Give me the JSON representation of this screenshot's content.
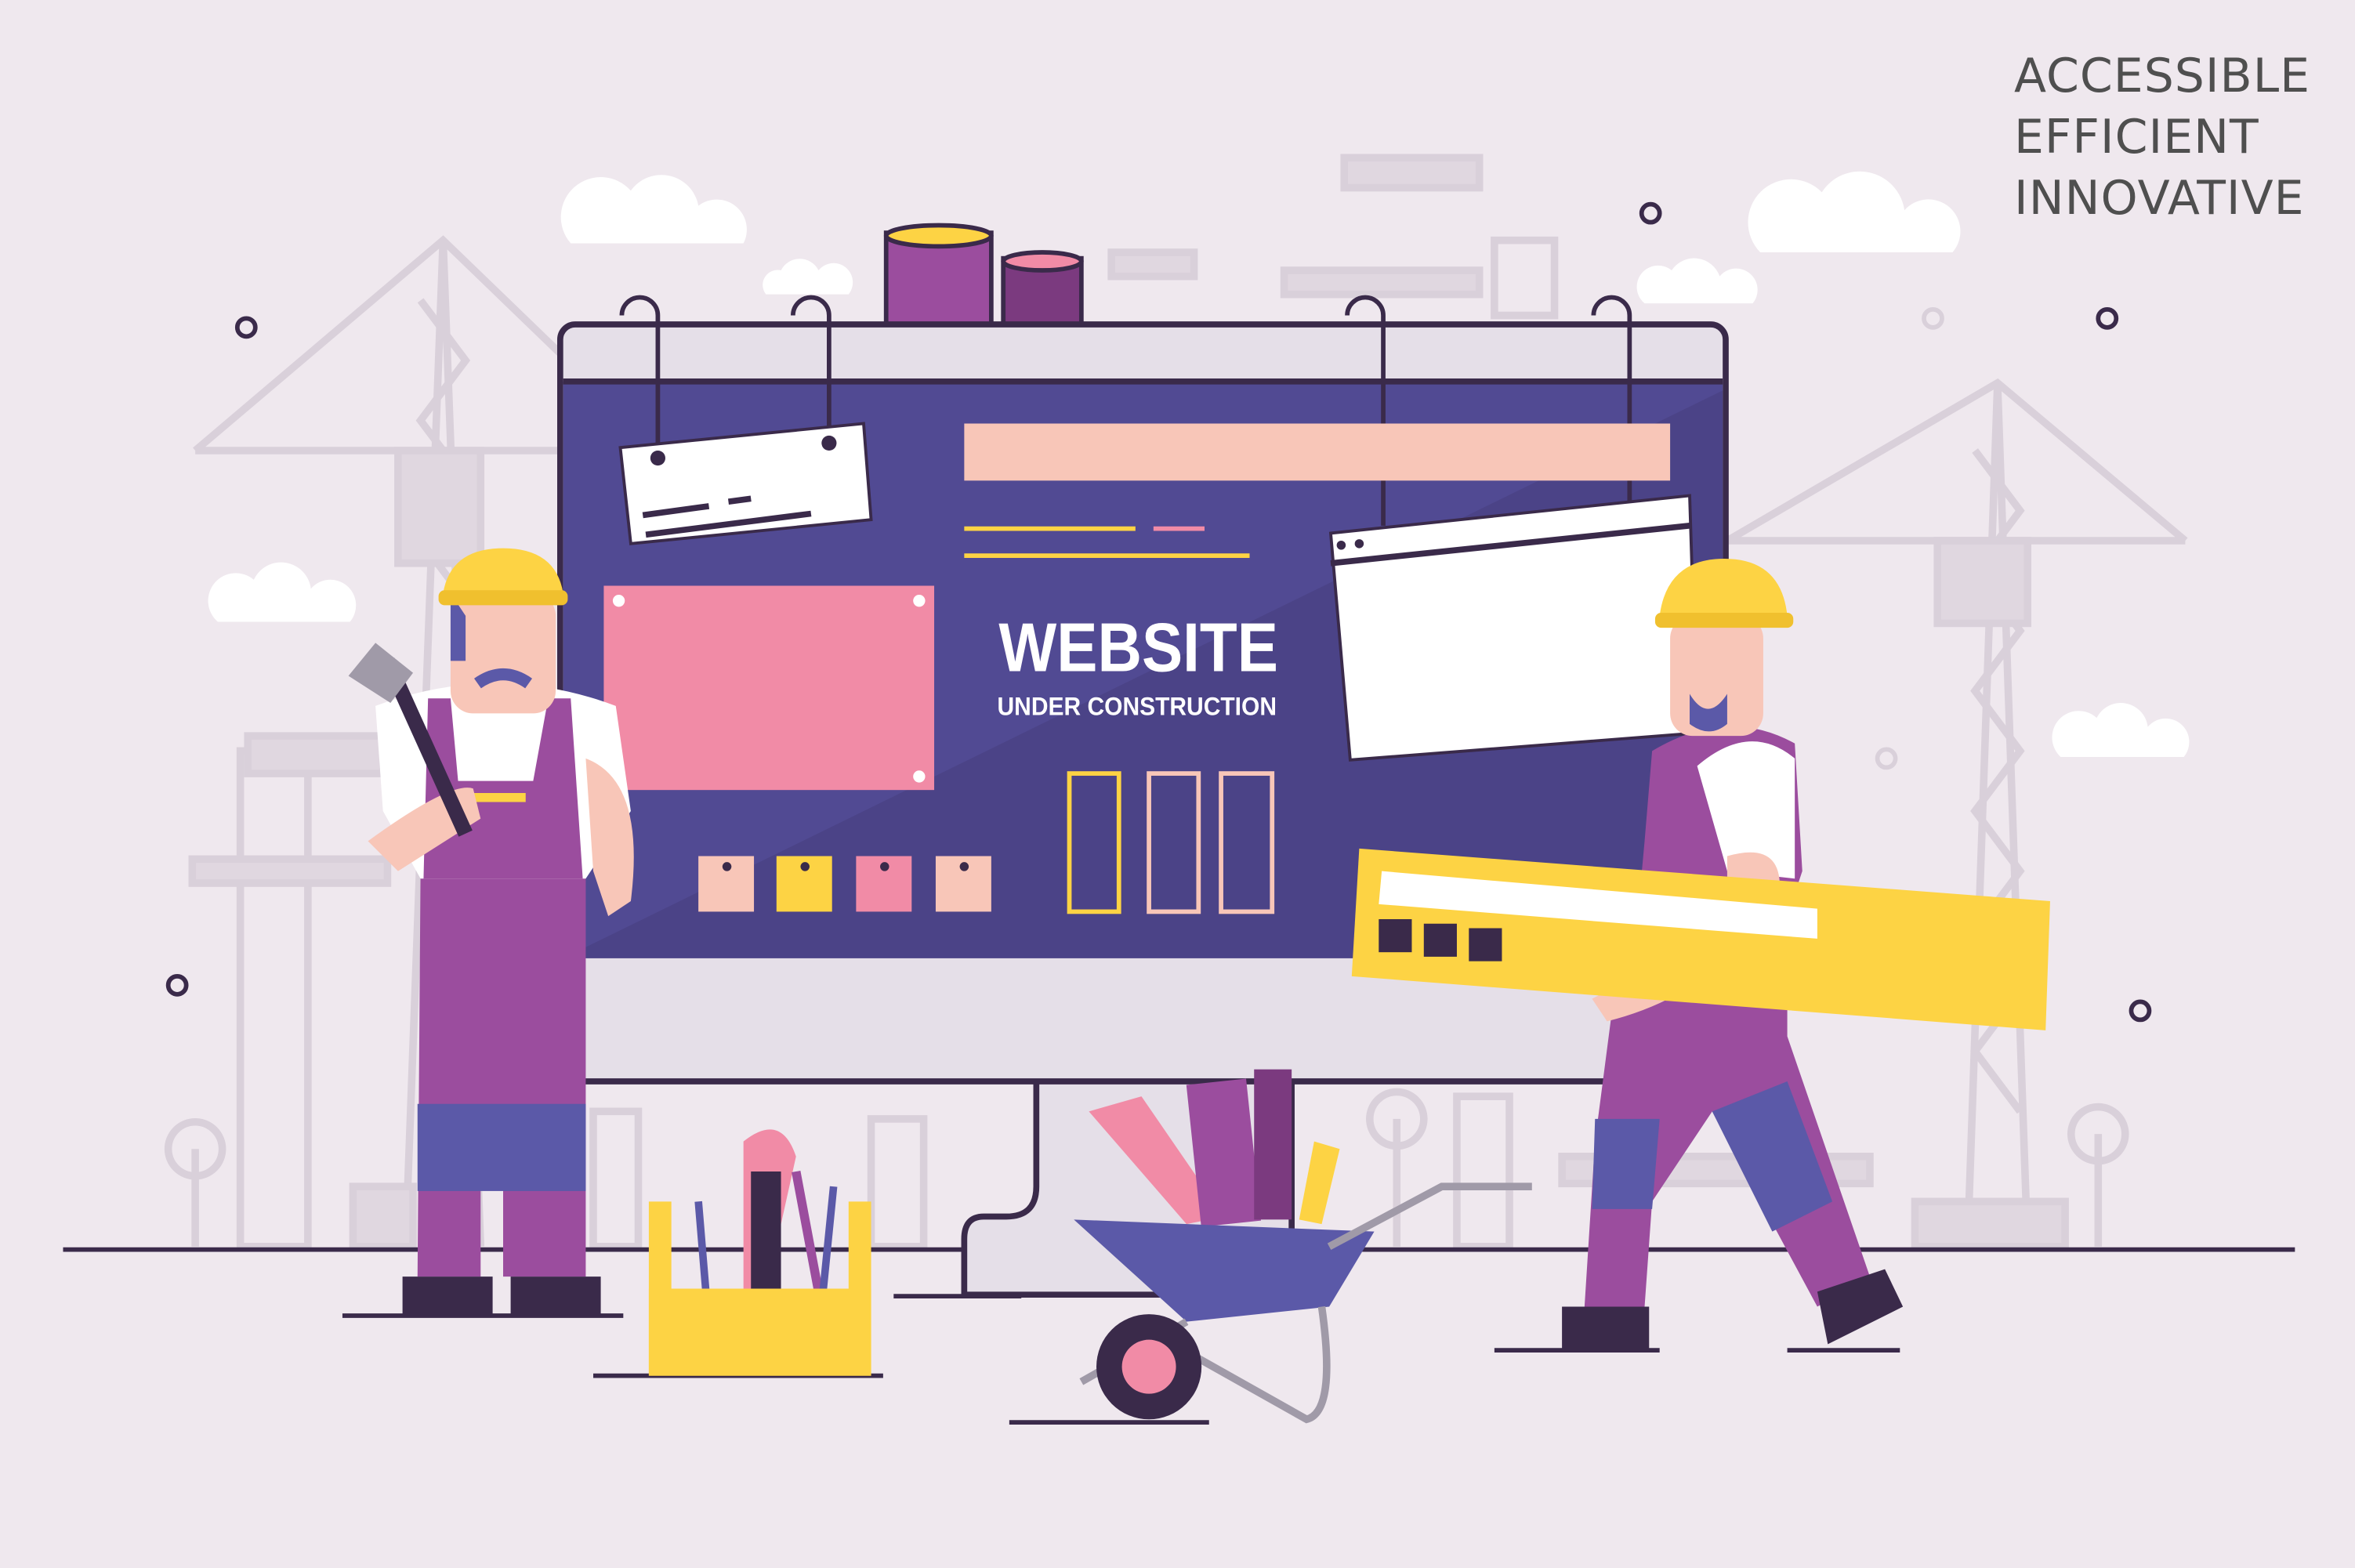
{
  "tagline": [
    "ACCESSIBLE",
    "EFFICIENT",
    "INNOVATIVE"
  ],
  "screen": {
    "headline": "WEBSITE",
    "subheadline": "UNDER CONSTRUCTION"
  },
  "colors": {
    "background": "#efe8ee",
    "screen": "#514a93",
    "frame": "#3a2a4a",
    "yellow": "#fdd344",
    "pink": "#f18ba6",
    "peach": "#f8c6b8",
    "purple": "#9b4d9e",
    "blue": "#5b59a8"
  }
}
